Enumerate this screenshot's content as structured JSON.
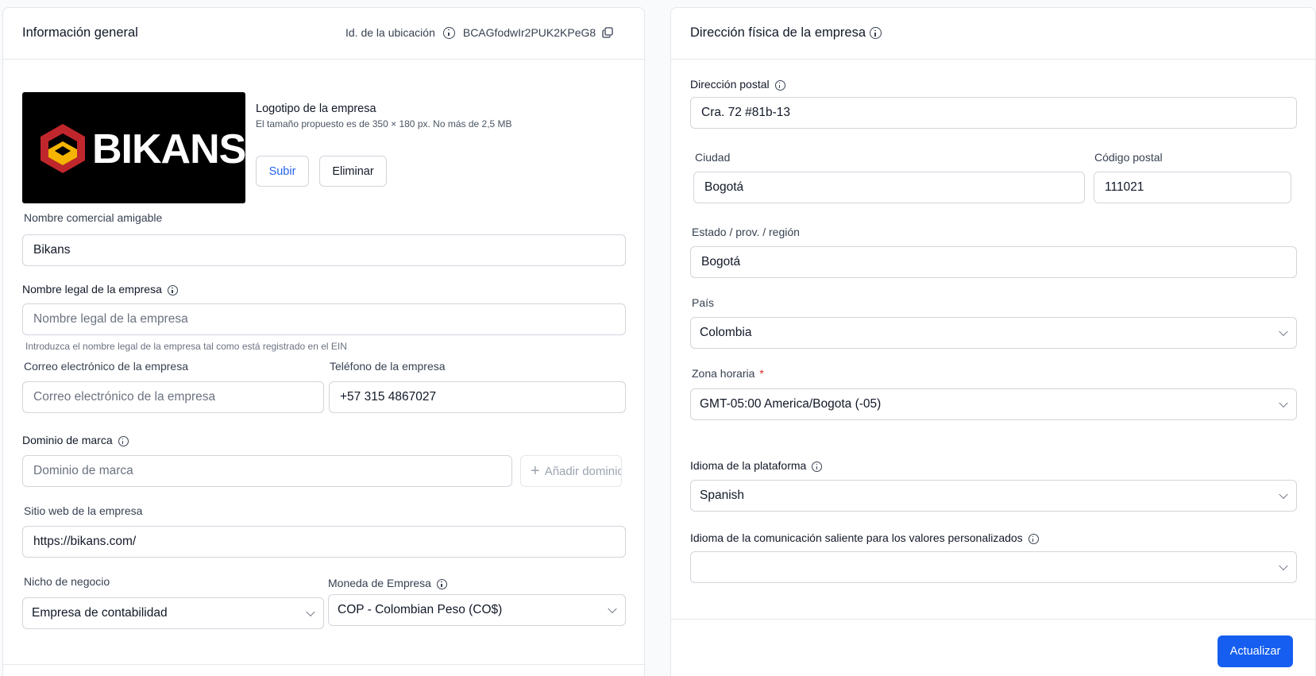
{
  "general": {
    "title": "Información general",
    "location_id_label": "Id. de la ubicación",
    "location_id_value": "BCAGfodwIr2PUK2KPeG8",
    "logo_text": "BIKANS",
    "logo_label": "Logotipo de la empresa",
    "logo_hint": "El tamaño propuesto es de 350 × 180 px. No más de 2,5 MB",
    "upload_label": "Subir",
    "delete_label": "Eliminar",
    "friendly_name_label": "Nombre comercial amigable",
    "friendly_name_value": "Bikans",
    "legal_name_label": "Nombre legal de la empresa",
    "legal_name_placeholder": "Nombre legal de la empresa",
    "legal_name_hint": "Introduzca el nombre legal de la empresa tal como está registrado en el EIN",
    "email_label": "Correo electrónico de la empresa",
    "email_placeholder": "Correo electrónico de la empresa",
    "phone_label": "Teléfono de la empresa",
    "phone_value": "+57 315 4867027",
    "brand_domain_label": "Dominio de marca",
    "brand_domain_placeholder": "Dominio de marca",
    "add_domain_label": "Añadir dominio",
    "website_label": "Sitio web de la empresa",
    "website_value": "https://bikans.com/",
    "niche_label": "Nicho de negocio",
    "niche_value": "Empresa de contabilidad",
    "currency_label": "Moneda de Empresa",
    "currency_value": "COP - Colombian Peso (CO$)"
  },
  "address": {
    "title": "Dirección física de la empresa",
    "postal_address_label": "Dirección postal",
    "postal_address_value": "Cra. 72 #81b-13",
    "city_label": "Ciudad",
    "city_value": "Bogotá",
    "zip_label": "Código postal",
    "zip_value": "111021",
    "state_label": "Estado / prov. / región",
    "state_value": "Bogotá",
    "country_label": "País",
    "country_value": "Colombia",
    "timezone_label": "Zona horaria",
    "timezone_required": "*",
    "timezone_value": "GMT-05:00 America/Bogota (-05)",
    "platform_language_label": "Idioma de la plataforma",
    "platform_language_value": "Spanish",
    "outbound_language_label": "Idioma de la comunicación saliente para los valores personalizados",
    "outbound_language_value": "",
    "update_label": "Actualizar"
  },
  "colors": {
    "primary": "#155eef",
    "border": "#d1d5db",
    "logo_bg": "#000000",
    "logo_red": "#c0272d",
    "logo_yellow": "#f4b400"
  }
}
